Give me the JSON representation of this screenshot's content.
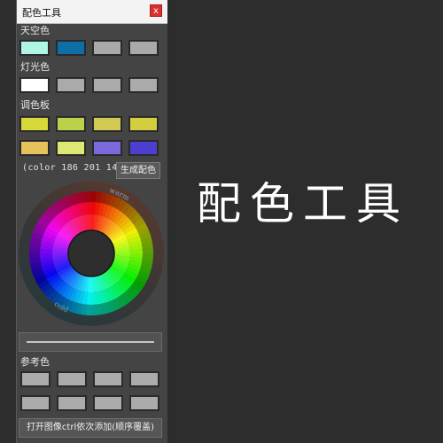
{
  "window": {
    "title": "配色工具",
    "close_label": "x"
  },
  "sky": {
    "label": "天空色",
    "swatches": [
      "#aef5e4",
      "#0e6fa6",
      "#aaaaaa",
      "#aaaaaa"
    ]
  },
  "light": {
    "label": "灯光色",
    "swatches": [
      "#ffffff",
      "#aaaaaa",
      "#aaaaaa",
      "#aaaaaa"
    ]
  },
  "palette": {
    "label": "调色板",
    "row1": [
      "#d7d83a",
      "#bcd14a",
      "#d1c954",
      "#d2ce3f"
    ],
    "row2": [
      "#e6c35a",
      "#dde874",
      "#7b69de",
      "#4c3fd0"
    ]
  },
  "color_text": "(color 186 201 14)",
  "generate_button": "生成配色",
  "wheel": {
    "warm_label": "warm",
    "cold_label": "cold"
  },
  "reference": {
    "label": "参考色",
    "swatches": [
      "#ababab",
      "#ababab",
      "#ababab",
      "#ababab",
      "#ababab",
      "#ababab",
      "#ababab",
      "#ababab"
    ]
  },
  "open_image_button": "打开图像ctrl依次添加(顺序覆盖)",
  "big_title": "配色工具"
}
